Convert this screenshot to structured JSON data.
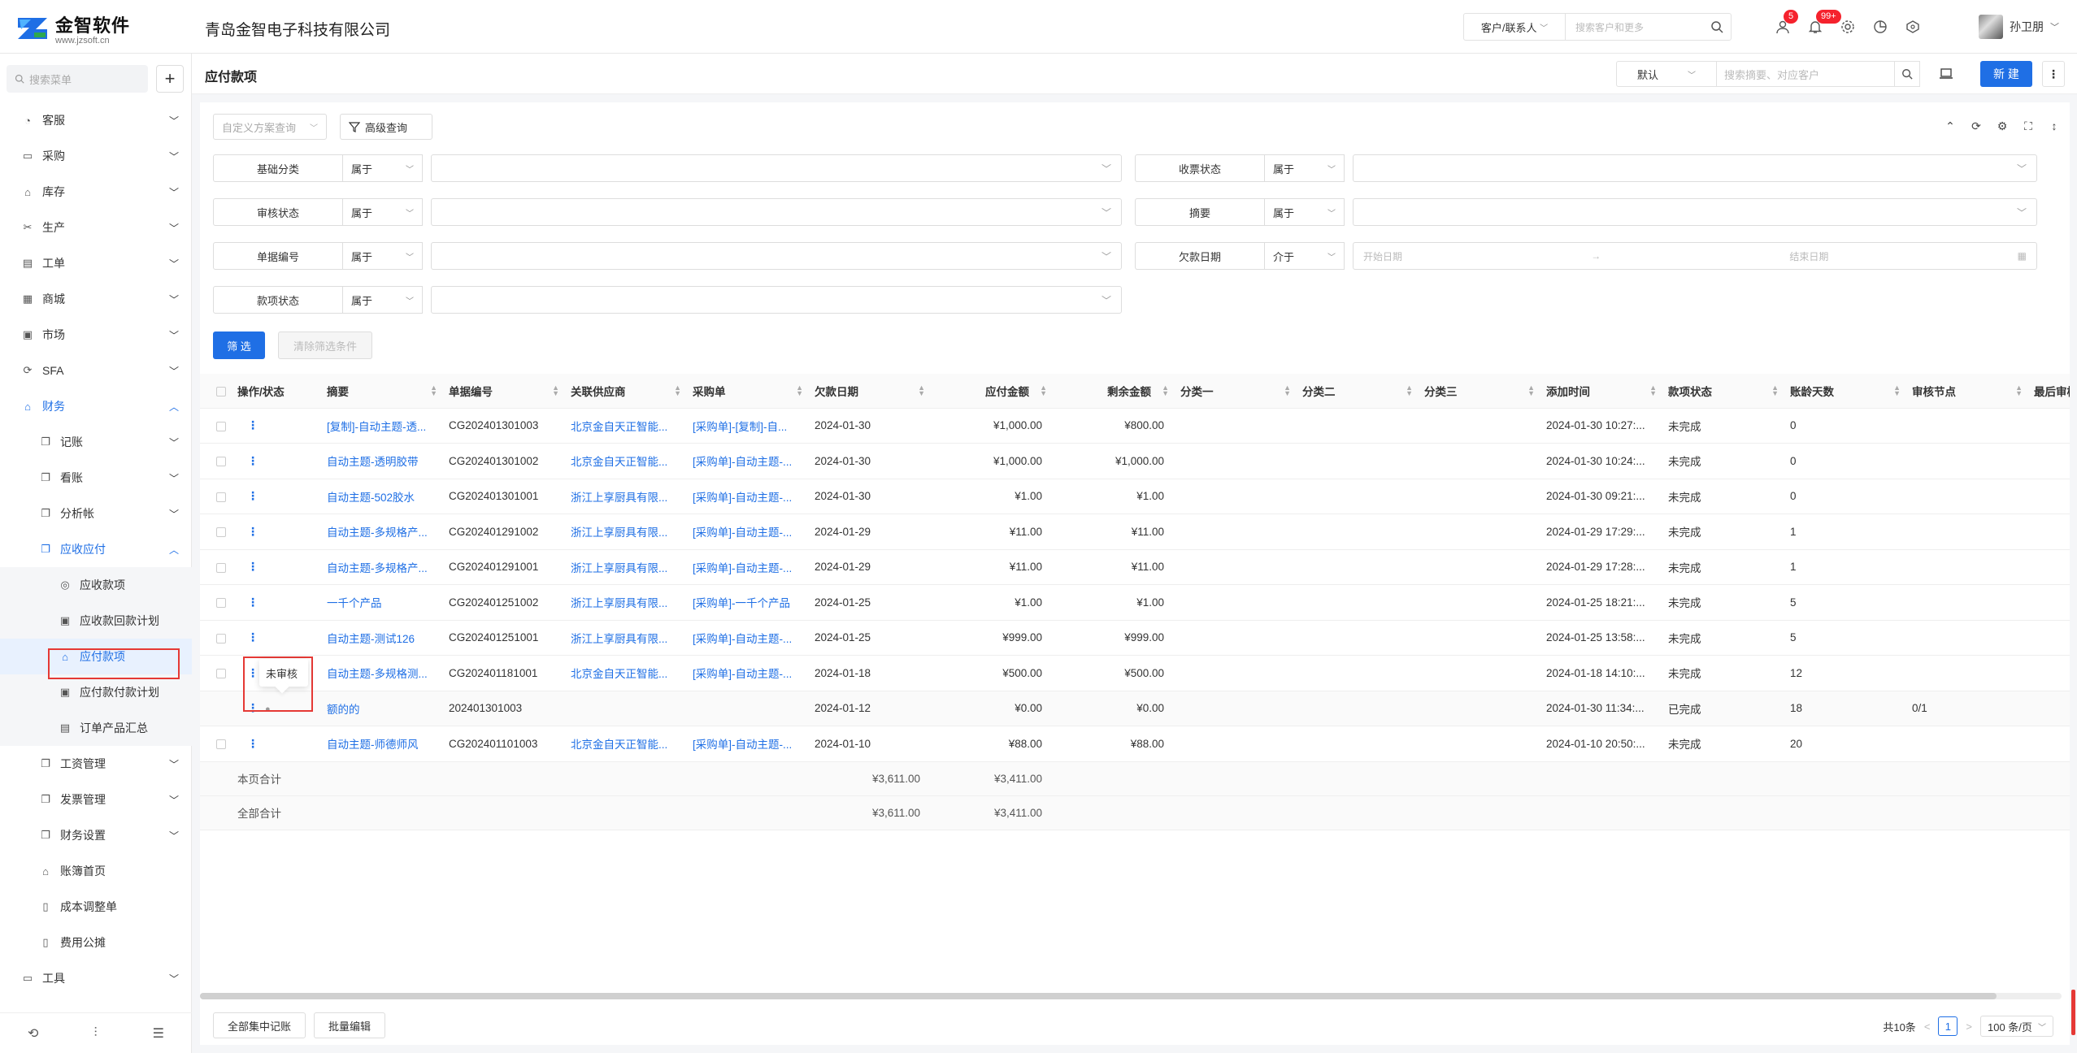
{
  "header": {
    "logo_title": "金智软件",
    "logo_sub": "www.jzsoft.cn",
    "company": "青岛金智电子科技有限公司",
    "search_scope": "客户/联系人",
    "search_placeholder": "搜索客户和更多",
    "badge_messages": "5",
    "badge_notifications": "99+",
    "user_name": "孙卫朋"
  },
  "sidebar": {
    "search_placeholder": "搜索菜单",
    "items": [
      {
        "label": "客服"
      },
      {
        "label": "采购"
      },
      {
        "label": "库存"
      },
      {
        "label": "生产"
      },
      {
        "label": "工单"
      },
      {
        "label": "商城"
      },
      {
        "label": "市场"
      },
      {
        "label": "SFA"
      },
      {
        "label": "财务"
      },
      {
        "label": "记账"
      },
      {
        "label": "看账"
      },
      {
        "label": "分析帐"
      },
      {
        "label": "应收应付"
      },
      {
        "label": "应收款项"
      },
      {
        "label": "应收款回款计划"
      },
      {
        "label": "应付款项"
      },
      {
        "label": "应付款付款计划"
      },
      {
        "label": "订单产品汇总"
      },
      {
        "label": "工资管理"
      },
      {
        "label": "发票管理"
      },
      {
        "label": "财务设置"
      },
      {
        "label": "账簿首页"
      },
      {
        "label": "成本调整单"
      },
      {
        "label": "费用公摊"
      },
      {
        "label": "工具"
      }
    ]
  },
  "page": {
    "title": "应付款项",
    "view_select": "默认",
    "search_placeholder": "搜索摘要、对应客户",
    "new_button": "新 建"
  },
  "query": {
    "custom_placeholder": "自定义方案查询",
    "advanced": "高级查询",
    "filter_button": "筛 选",
    "clear_button": "清除筛选条件",
    "filters": [
      {
        "label": "基础分类",
        "op": "属于"
      },
      {
        "label": "收票状态",
        "op": "属于"
      },
      {
        "label": "审核状态",
        "op": "属于"
      },
      {
        "label": "摘要",
        "op": "属于"
      },
      {
        "label": "单据编号",
        "op": "属于"
      },
      {
        "label": "欠款日期",
        "op": "介于",
        "start": "开始日期",
        "end": "结束日期"
      },
      {
        "label": "款项状态",
        "op": "属于"
      }
    ]
  },
  "table": {
    "headers": [
      "操作/状态",
      "摘要",
      "单据编号",
      "关联供应商",
      "采购单",
      "欠款日期",
      "应付金额",
      "剩余金额",
      "分类一",
      "分类二",
      "分类三",
      "添加时间",
      "款项状态",
      "账龄天数",
      "审核节点",
      "最后审核"
    ],
    "rows": [
      [
        "[复制]-自动主题-透...",
        "CG202401301003",
        "北京金自天正智能...",
        "[采购单]-[复制]-自...",
        "2024-01-30",
        "¥1,000.00",
        "¥800.00",
        "2024-01-30 10:27:...",
        "未完成",
        "0",
        ""
      ],
      [
        "自动主题-透明胶带",
        "CG202401301002",
        "北京金自天正智能...",
        "[采购单]-自动主题-...",
        "2024-01-30",
        "¥1,000.00",
        "¥1,000.00",
        "2024-01-30 10:24:...",
        "未完成",
        "0",
        ""
      ],
      [
        "自动主题-502胶水",
        "CG202401301001",
        "浙江上享厨具有限...",
        "[采购单]-自动主题-...",
        "2024-01-30",
        "¥1.00",
        "¥1.00",
        "2024-01-30 09:21:...",
        "未完成",
        "0",
        ""
      ],
      [
        "自动主题-多规格产...",
        "CG202401291002",
        "浙江上享厨具有限...",
        "[采购单]-自动主题-...",
        "2024-01-29",
        "¥11.00",
        "¥11.00",
        "2024-01-29 17:29:...",
        "未完成",
        "1",
        ""
      ],
      [
        "自动主题-多规格产...",
        "CG202401291001",
        "浙江上享厨具有限...",
        "[采购单]-自动主题-...",
        "2024-01-29",
        "¥11.00",
        "¥11.00",
        "2024-01-29 17:28:...",
        "未完成",
        "1",
        ""
      ],
      [
        "一千个产品",
        "CG202401251002",
        "浙江上享厨具有限...",
        "[采购单]-一千个产品",
        "2024-01-25",
        "¥1.00",
        "¥1.00",
        "2024-01-25 18:21:...",
        "未完成",
        "5",
        ""
      ],
      [
        "自动主题-测试126",
        "CG202401251001",
        "浙江上享厨具有限...",
        "[采购单]-自动主题-...",
        "2024-01-25",
        "¥999.00",
        "¥999.00",
        "2024-01-25 13:58:...",
        "未完成",
        "5",
        ""
      ],
      [
        "自动主题-多规格测...",
        "CG202401181001",
        "北京金自天正智能...",
        "[采购单]-自动主题-...",
        "2024-01-18",
        "¥500.00",
        "¥500.00",
        "2024-01-18 14:10:...",
        "未完成",
        "12",
        ""
      ],
      [
        "额的的",
        "202401301003",
        "",
        "",
        "2024-01-12",
        "¥0.00",
        "¥0.00",
        "2024-01-30 11:34:...",
        "已完成",
        "18",
        "0/1"
      ],
      [
        "自动主题-师德师风",
        "CG202401101003",
        "北京金自天正智能...",
        "[采购单]-自动主题-...",
        "2024-01-10",
        "¥88.00",
        "¥88.00",
        "2024-01-10 20:50:...",
        "未完成",
        "20",
        ""
      ]
    ],
    "page_sum_label": "本页合计",
    "page_sum_payable": "¥3,611.00",
    "page_sum_remaining": "¥3,411.00",
    "total_sum_label": "全部合计",
    "total_sum_payable": "¥3,611.00",
    "total_sum_remaining": "¥3,411.00",
    "popup_status": "未审核"
  },
  "footer": {
    "bulk_post": "全部集中记账",
    "bulk_edit": "批量编辑",
    "total": "共10条",
    "page": "1",
    "page_size": "100 条/页"
  },
  "colors": {
    "primary": "#1f6fe5",
    "highlight": "#e53935"
  }
}
